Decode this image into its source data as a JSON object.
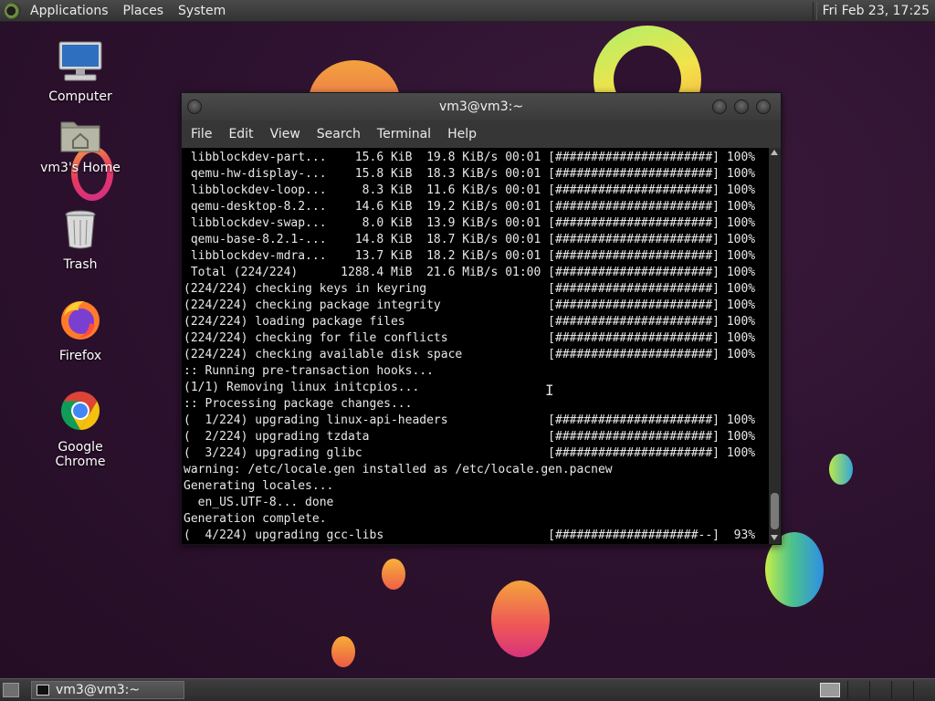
{
  "top_panel": {
    "menus": [
      "Applications",
      "Places",
      "System"
    ],
    "clock": "Fri Feb 23, 17:25"
  },
  "desktop_icons": [
    {
      "label": "Computer",
      "icon": "computer-icon"
    },
    {
      "label": "vm3's Home",
      "icon": "home-folder-icon"
    },
    {
      "label": "Trash",
      "icon": "trash-icon"
    },
    {
      "label": "Firefox",
      "icon": "firefox-icon"
    },
    {
      "label": "Google Chrome",
      "icon": "chrome-icon"
    }
  ],
  "terminal": {
    "title": "vm3@vm3:~",
    "menu": [
      "File",
      "Edit",
      "View",
      "Search",
      "Terminal",
      "Help"
    ],
    "lines": [
      " libblockdev-part...    15.6 KiB  19.8 KiB/s 00:01 [######################] 100%",
      " qemu-hw-display-...    15.8 KiB  18.3 KiB/s 00:01 [######################] 100%",
      " libblockdev-loop...     8.3 KiB  11.6 KiB/s 00:01 [######################] 100%",
      " qemu-desktop-8.2...    14.6 KiB  19.2 KiB/s 00:01 [######################] 100%",
      " libblockdev-swap...     8.0 KiB  13.9 KiB/s 00:01 [######################] 100%",
      " qemu-base-8.2.1-...    14.8 KiB  18.7 KiB/s 00:01 [######################] 100%",
      " libblockdev-mdra...    13.7 KiB  18.2 KiB/s 00:01 [######################] 100%",
      " Total (224/224)      1288.4 MiB  21.6 MiB/s 01:00 [######################] 100%",
      "(224/224) checking keys in keyring                 [######################] 100%",
      "(224/224) checking package integrity               [######################] 100%",
      "(224/224) loading package files                    [######################] 100%",
      "(224/224) checking for file conflicts              [######################] 100%",
      "(224/224) checking available disk space            [######################] 100%",
      ":: Running pre-transaction hooks...",
      "(1/1) Removing linux initcpios...",
      ":: Processing package changes...",
      "(  1/224) upgrading linux-api-headers              [######################] 100%",
      "(  2/224) upgrading tzdata                         [######################] 100%",
      "(  3/224) upgrading glibc                          [######################] 100%",
      "warning: /etc/locale.gen installed as /etc/locale.gen.pacnew",
      "Generating locales...",
      "  en_US.UTF-8... done",
      "Generation complete.",
      "(  4/224) upgrading gcc-libs                       [####################--]  93%"
    ],
    "scroll_position": 0.9
  },
  "bottom_panel": {
    "task_label": "vm3@vm3:~"
  },
  "colors": {
    "panel": "#3a3a3a",
    "terminal_bg": "#000000",
    "terminal_fg": "#e8e8e8"
  }
}
